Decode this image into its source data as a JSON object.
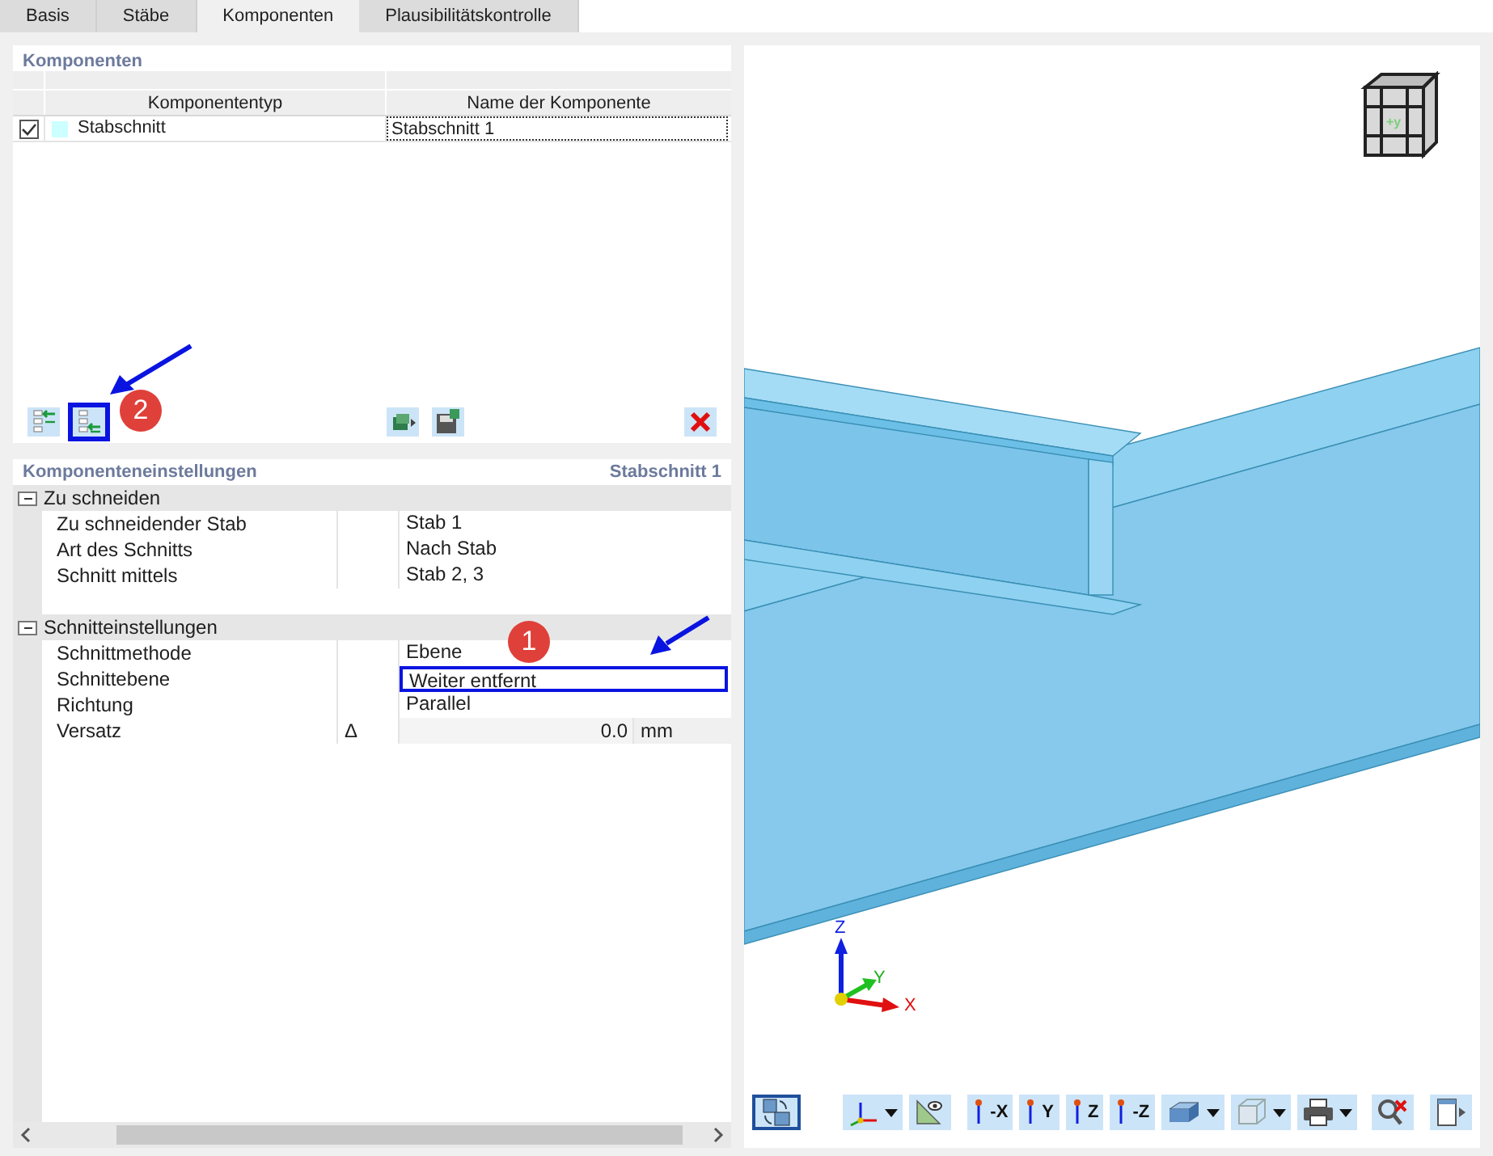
{
  "tabs": [
    {
      "label": "Basis",
      "selected": false
    },
    {
      "label": "Stäbe",
      "selected": false
    },
    {
      "label": "Komponenten",
      "selected": true
    },
    {
      "label": "Plausibilitätskontrolle",
      "selected": false
    }
  ],
  "components": {
    "title": "Komponenten",
    "columns": [
      "Komponententyp",
      "Name der Komponente"
    ],
    "rows": [
      {
        "checked": true,
        "type": "Stabschnitt",
        "color": "#ccffff",
        "name": "Stabschnitt 1"
      }
    ]
  },
  "component_toolbar": [
    {
      "kind": "insert-before"
    },
    {
      "kind": "insert-after",
      "highlighted": true,
      "callout": "2"
    },
    {
      "kind": "import"
    },
    {
      "kind": "save"
    },
    {
      "kind": "delete"
    }
  ],
  "settings": {
    "title": "Komponenteneinstellungen",
    "subtitle": "Stabschnitt 1",
    "groups": [
      {
        "label": "Zu schneiden",
        "expanded": true,
        "rows": [
          {
            "label": "Zu schneidender Stab",
            "value": "Stab 1"
          },
          {
            "label": "Art des Schnitts",
            "value": "Nach Stab"
          },
          {
            "label": "Schnitt mittels",
            "value": "Stab 2, 3"
          }
        ]
      },
      {
        "label": "Schnitteinstellungen",
        "expanded": true,
        "rows": [
          {
            "label": "Schnittmethode",
            "value": "Ebene"
          },
          {
            "label": "Schnittebene",
            "value": "Weiter entfernt",
            "highlighted": true,
            "callout": "1"
          },
          {
            "label": "Richtung",
            "value": "Parallel"
          },
          {
            "label": "Versatz",
            "symbol": "Δ",
            "value": "0.0",
            "unit": "mm"
          }
        ]
      }
    ]
  },
  "viewport": {
    "cube_label": "+y",
    "axes": {
      "x": "X",
      "y": "Y",
      "z": "Z"
    },
    "toolbar": [
      {
        "kind": "view-switch",
        "active": true
      },
      {
        "kind": "axes",
        "active": false,
        "dropdown": true
      },
      {
        "kind": "measure",
        "active": false
      },
      {
        "kind": "view",
        "label": "-X",
        "active": false
      },
      {
        "kind": "view",
        "label": "Y",
        "active": false
      },
      {
        "kind": "view",
        "label": "Z",
        "active": false
      },
      {
        "kind": "view",
        "label": "-Z",
        "active": false
      },
      {
        "kind": "render",
        "active": false,
        "dropdown": true
      },
      {
        "kind": "wireframe",
        "active": false,
        "dropdown": true
      },
      {
        "kind": "print",
        "active": false,
        "dropdown": true
      },
      {
        "kind": "zoom-reset",
        "active": false
      },
      {
        "kind": "panel",
        "active": false
      }
    ]
  }
}
